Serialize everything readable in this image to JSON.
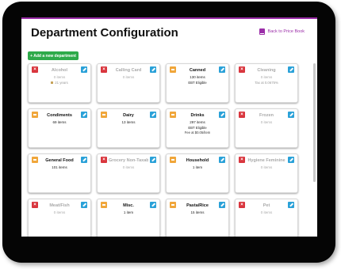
{
  "header": {
    "title": "Department Configuration",
    "back_link": "Back to Price Book"
  },
  "toolbar": {
    "add_label": "+ Add a new department"
  },
  "colors": {
    "accent": "#9b2ea8",
    "add_green": "#2eaa4a",
    "delete_red": "#d9363e",
    "restore_orange": "#f0a63a",
    "edit_blue": "#2aa1d8"
  },
  "departments": [
    {
      "name": "Alcohol",
      "count": "0 items",
      "extra": "21 years",
      "extra2": "",
      "status": "inactive",
      "badge": "red"
    },
    {
      "name": "Calling Card",
      "count": "0 items",
      "extra": "",
      "extra2": "",
      "status": "inactive",
      "badge": "red"
    },
    {
      "name": "Canned",
      "count": "130 items",
      "extra": "EBT Eligible",
      "extra2": "",
      "status": "active",
      "badge": "orange"
    },
    {
      "name": "Cleaning",
      "count": "0 items",
      "extra": "Tax at 0.0675%",
      "extra2": "",
      "status": "inactive",
      "badge": "red"
    },
    {
      "name": "Condiments",
      "count": "69 items",
      "extra": "",
      "extra2": "",
      "status": "active",
      "badge": "orange"
    },
    {
      "name": "Dairy",
      "count": "13 items",
      "extra": "",
      "extra2": "",
      "status": "active",
      "badge": "orange"
    },
    {
      "name": "Drinks",
      "count": "297 items",
      "extra": "EBT Eligible",
      "extra2": "Fee at $0.05/item",
      "status": "active",
      "badge": "orange"
    },
    {
      "name": "Frozen",
      "count": "0 items",
      "extra": "",
      "extra2": "",
      "status": "inactive",
      "badge": "red"
    },
    {
      "name": "General Food",
      "count": "101 items",
      "extra": "",
      "extra2": "",
      "status": "active",
      "badge": "orange"
    },
    {
      "name": "Grocery Non-Taxable",
      "count": "0 items",
      "extra": "",
      "extra2": "",
      "status": "inactive",
      "badge": "red"
    },
    {
      "name": "Household",
      "count": "1 item",
      "extra": "",
      "extra2": "",
      "status": "active",
      "badge": "orange"
    },
    {
      "name": "Hygiene Feminine",
      "count": "0 items",
      "extra": "",
      "extra2": "",
      "status": "inactive",
      "badge": "red"
    },
    {
      "name": "Meat/Fish",
      "count": "0 items",
      "extra": "",
      "extra2": "",
      "status": "inactive",
      "badge": "red"
    },
    {
      "name": "Misc.",
      "count": "1 item",
      "extra": "",
      "extra2": "",
      "status": "active",
      "badge": "orange"
    },
    {
      "name": "Pasta/Rice",
      "count": "15 items",
      "extra": "",
      "extra2": "",
      "status": "active",
      "badge": "orange"
    },
    {
      "name": "Pet",
      "count": "0 items",
      "extra": "",
      "extra2": "",
      "status": "inactive",
      "badge": "red"
    }
  ]
}
